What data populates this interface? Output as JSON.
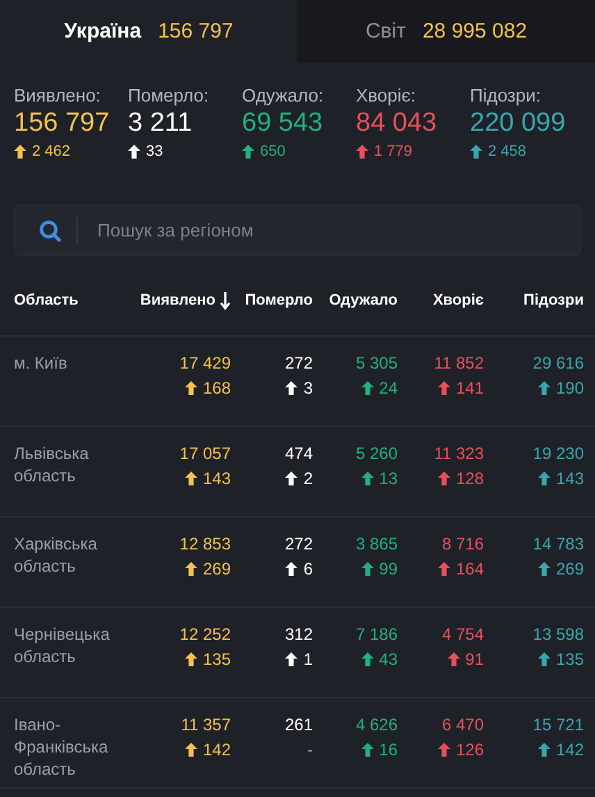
{
  "tabs": [
    {
      "label": "Україна",
      "value": "156 797",
      "selected": true
    },
    {
      "label": "Світ",
      "value": "28 995 082",
      "selected": false
    }
  ],
  "stats": [
    {
      "label": "Виявлено:",
      "value": "156 797",
      "delta": "2 462",
      "color": "#f2c14e"
    },
    {
      "label": "Померло:",
      "value": "3 211",
      "delta": "33",
      "color": "#ffffff"
    },
    {
      "label": "Одужало:",
      "value": "69 543",
      "delta": "650",
      "color": "#22b07d"
    },
    {
      "label": "Хворіє:",
      "value": "84 043",
      "delta": "1 779",
      "color": "#e5515a"
    },
    {
      "label": "Підозри:",
      "value": "220 099",
      "delta": "2 458",
      "color": "#3aa6ab"
    }
  ],
  "search": {
    "placeholder": "Пошук за регіоном"
  },
  "table": {
    "name_column": "Область",
    "columns": [
      {
        "label": "Виявлено",
        "sorted": true,
        "color": "#f2c14e"
      },
      {
        "label": "Померло",
        "sorted": false,
        "color": "#ffffff"
      },
      {
        "label": "Одужало",
        "sorted": false,
        "color": "#22b07d"
      },
      {
        "label": "Хворіє",
        "sorted": false,
        "color": "#e5515a"
      },
      {
        "label": "Підозри",
        "sorted": false,
        "color": "#3aa6ab"
      }
    ],
    "rows": [
      {
        "name": "м. Київ",
        "cells": [
          {
            "value": "17 429",
            "delta": "168",
            "arrow": true
          },
          {
            "value": "272",
            "delta": "3",
            "arrow": true
          },
          {
            "value": "5 305",
            "delta": "24",
            "arrow": true
          },
          {
            "value": "11 852",
            "delta": "141",
            "arrow": true
          },
          {
            "value": "29 616",
            "delta": "190",
            "arrow": true
          }
        ]
      },
      {
        "name": "Львівська область",
        "cells": [
          {
            "value": "17 057",
            "delta": "143",
            "arrow": true
          },
          {
            "value": "474",
            "delta": "2",
            "arrow": true
          },
          {
            "value": "5 260",
            "delta": "13",
            "arrow": true
          },
          {
            "value": "11 323",
            "delta": "128",
            "arrow": true
          },
          {
            "value": "19 230",
            "delta": "143",
            "arrow": true
          }
        ]
      },
      {
        "name": "Харківська область",
        "cells": [
          {
            "value": "12 853",
            "delta": "269",
            "arrow": true
          },
          {
            "value": "272",
            "delta": "6",
            "arrow": true
          },
          {
            "value": "3 865",
            "delta": "99",
            "arrow": true
          },
          {
            "value": "8 716",
            "delta": "164",
            "arrow": true
          },
          {
            "value": "14 783",
            "delta": "269",
            "arrow": true
          }
        ]
      },
      {
        "name": "Чернівецька область",
        "cells": [
          {
            "value": "12 252",
            "delta": "135",
            "arrow": true
          },
          {
            "value": "312",
            "delta": "1",
            "arrow": true
          },
          {
            "value": "7 186",
            "delta": "43",
            "arrow": true
          },
          {
            "value": "4 754",
            "delta": "91",
            "arrow": true
          },
          {
            "value": "13 598",
            "delta": "135",
            "arrow": true
          }
        ]
      },
      {
        "name": "Івано-Франківська область",
        "cells": [
          {
            "value": "11 357",
            "delta": "142",
            "arrow": true
          },
          {
            "value": "261",
            "delta": "-",
            "arrow": false
          },
          {
            "value": "4 626",
            "delta": "16",
            "arrow": true
          },
          {
            "value": "6 470",
            "delta": "126",
            "arrow": true
          },
          {
            "value": "15 721",
            "delta": "142",
            "arrow": true
          }
        ]
      }
    ]
  }
}
